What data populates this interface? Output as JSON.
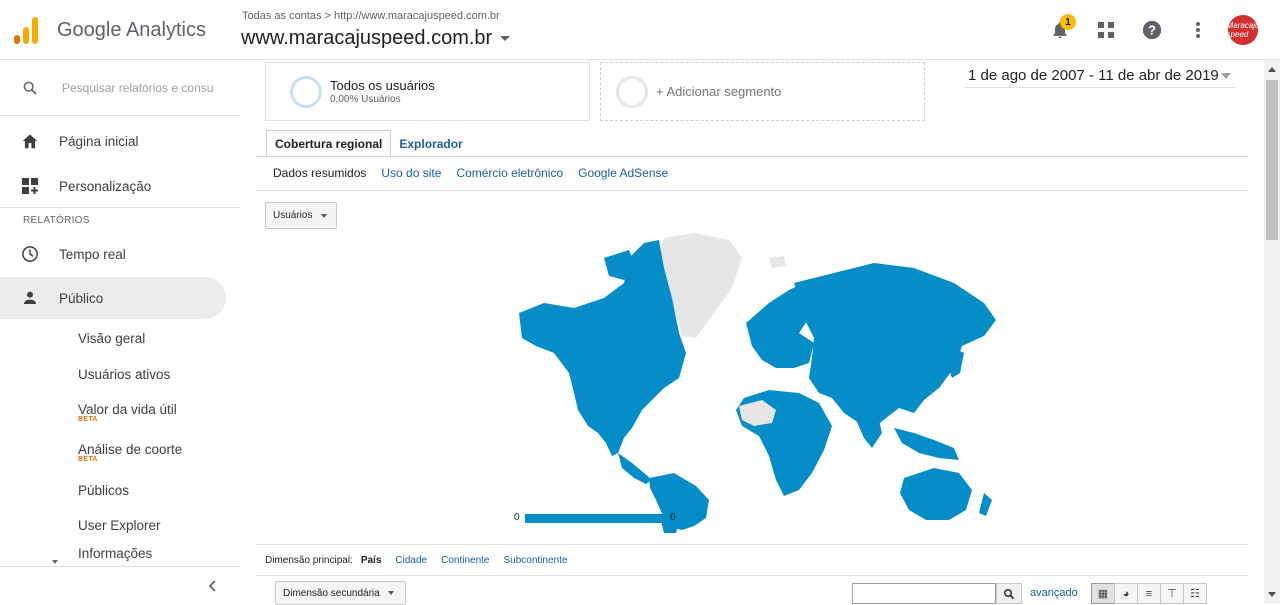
{
  "header": {
    "brand": "Google Analytics",
    "breadcrumb": "Todas as contas > http://www.maracajuspeed.com.br",
    "property": "www.maracajuspeed.com.br",
    "notification_count": "1",
    "avatar_text": "Maracaju speed",
    "logo_colors": [
      "#f9ab00",
      "#e37400"
    ]
  },
  "sidebar": {
    "search_placeholder": "Pesquisar relatórios e consultas",
    "home": "Página inicial",
    "customization": "Personalização",
    "section_label": "RELATÓRIOS",
    "realtime": "Tempo real",
    "audience": "Público",
    "sub_items": {
      "overview": "Visão geral",
      "active_users": "Usuários ativos",
      "lifetime_value": "Valor da vida útil",
      "cohort": "Análise de coorte",
      "audiences": "Públicos",
      "user_explorer": "User Explorer",
      "insights": "Informações"
    },
    "beta_label": "BETA"
  },
  "segments": {
    "active_title": "Todos os usuários",
    "active_sub": "0,00% Usuários",
    "add_segment": "+ Adicionar segmento"
  },
  "date_range": "1 de ago de 2007 - 11 de abr de 2019",
  "tabs": {
    "regional": "Cobertura regional",
    "explorer": "Explorador"
  },
  "subtabs": {
    "summary": "Dados resumidos",
    "site_usage": "Uso do site",
    "ecommerce": "Comércio eletrônico",
    "adsense": "Google AdSense"
  },
  "metric_dropdown": "Usuários",
  "map": {
    "legend_min": "0",
    "legend_max": "0",
    "fill_color": "#058dc7",
    "empty_color": "#e6e6e6"
  },
  "dimensions": {
    "label": "Dimensão principal:",
    "country": "País",
    "city": "Cidade",
    "continent": "Continente",
    "subcontinent": "Subcontinente"
  },
  "table_controls": {
    "secondary_dimension": "Dimensão secundária",
    "advanced": "avançado"
  }
}
